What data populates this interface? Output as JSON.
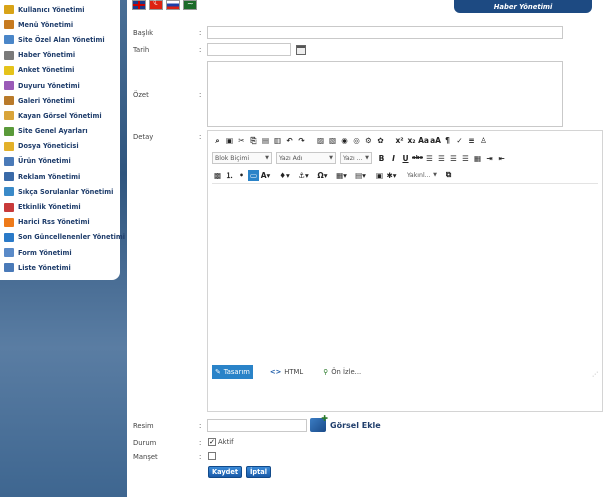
{
  "sidebar": {
    "items": [
      {
        "label": "Kullanıcı Yönetimi",
        "icon": "key-icon",
        "color": "#d8a317"
      },
      {
        "label": "Menü Yönetimi",
        "icon": "pencil-icon",
        "color": "#c77a1f"
      },
      {
        "label": "Site Özel Alan Yönetimi",
        "icon": "page-icon",
        "color": "#4a86c8"
      },
      {
        "label": "Haber Yönetimi",
        "icon": "tag-icon",
        "color": "#7a7a7a"
      },
      {
        "label": "Anket Yönetimi",
        "icon": "lightbulb-icon",
        "color": "#e5c31a"
      },
      {
        "label": "Duyuru Yönetimi",
        "icon": "announce-icon",
        "color": "#9a5ab8"
      },
      {
        "label": "Galeri Yönetimi",
        "icon": "gallery-icon",
        "color": "#b97a2a"
      },
      {
        "label": "Kayan Görsel Yönetimi",
        "icon": "jar-icon",
        "color": "#d9a43a"
      },
      {
        "label": "Site Genel Ayarları",
        "icon": "gear-icon",
        "color": "#5a9a3a"
      },
      {
        "label": "Dosya Yöneticisi",
        "icon": "folder-icon",
        "color": "#e3b12a"
      },
      {
        "label": "Ürün Yönetimi",
        "icon": "list-icon",
        "color": "#4a7ab8"
      },
      {
        "label": "Reklam Yönetimi",
        "icon": "monitor-icon",
        "color": "#3a6aa8"
      },
      {
        "label": "Sıkça Sorulanlar Yönetimi",
        "icon": "help-icon",
        "color": "#3a8ac8"
      },
      {
        "label": "Etkinlik Yönetimi",
        "icon": "calendar-icon",
        "color": "#c83a3a"
      },
      {
        "label": "Harici Rss Yönetimi",
        "icon": "rss-icon",
        "color": "#ee7a1a"
      },
      {
        "label": "Son Güncellenenler Yönetimi",
        "icon": "flag-icon",
        "color": "#2a7ac8"
      },
      {
        "label": "Form Yönetimi",
        "icon": "form-icon",
        "color": "#5a8ac8"
      },
      {
        "label": "Liste Yönetimi",
        "icon": "table-icon",
        "color": "#4a7ab8"
      }
    ]
  },
  "header": {
    "title": "Haber Yönetimi"
  },
  "form": {
    "baslik_label": "Başlık",
    "tarih_label": "Tarih",
    "ozet_label": "Özet",
    "detay_label": "Detay",
    "resim_label": "Resim",
    "durum_label": "Durum",
    "manset_label": "Manşet",
    "colon": ":",
    "aktif_label": "Aktif",
    "aktif_checked": true,
    "manset_checked": false,
    "gorsel_ekle": "Görsel Ekle"
  },
  "editor": {
    "block_format": "Blok Biçimi",
    "font_name": "Yazı Adı",
    "font_size": "Yazı ...",
    "modes": [
      "Tasarım",
      "HTML",
      "Ön İzle..."
    ],
    "toolbar_row1": [
      "find-icon",
      "select-all-icon",
      "cut-icon",
      "copy-icon",
      "paste-icon",
      "paste-text-icon",
      "undo-icon",
      "redo-icon",
      "image-icon",
      "image-manager-icon",
      "flash-icon",
      "media-icon",
      "document-icon",
      "template-icon",
      "superscript-icon",
      "subscript-icon",
      "case-icon",
      "strike-case-icon",
      "paragraph-icon",
      "spell-icon",
      "align-icon",
      "clean-icon"
    ],
    "toolbar_row2": [
      "B",
      "I",
      "U",
      "abc"
    ]
  },
  "buttons": {
    "save": "Kaydet",
    "cancel": "İptal"
  },
  "colors": {
    "accent": "#1d4a82",
    "button": "#1a5aa8"
  }
}
